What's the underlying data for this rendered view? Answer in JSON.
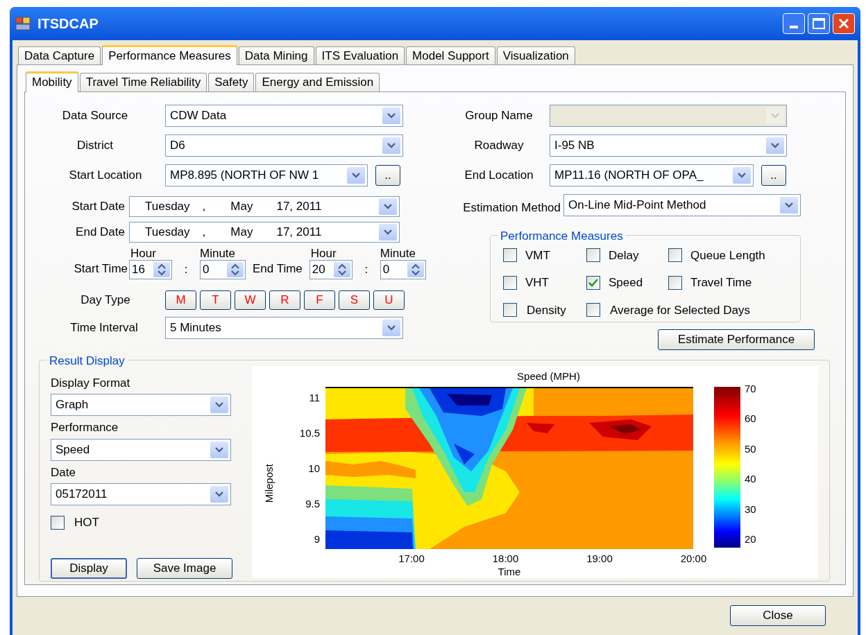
{
  "window": {
    "title": "ITSDCAP"
  },
  "tabs": [
    {
      "label": "Data Capture",
      "selected": false
    },
    {
      "label": "Performance Measures",
      "selected": true
    },
    {
      "label": "Data Mining",
      "selected": false
    },
    {
      "label": "ITS Evaluation",
      "selected": false
    },
    {
      "label": "Model Support",
      "selected": false
    },
    {
      "label": "Visualization",
      "selected": false
    }
  ],
  "subtabs": [
    {
      "label": "Mobility",
      "selected": true
    },
    {
      "label": "Travel Time Reliability",
      "selected": false
    },
    {
      "label": "Safety",
      "selected": false
    },
    {
      "label": "Energy and Emission",
      "selected": false
    }
  ],
  "data_source": {
    "label": "Data Source",
    "value": "CDW Data"
  },
  "district": {
    "label": "District",
    "value": "D6"
  },
  "start_location": {
    "label": "Start Location",
    "value": "MP8.895 (NORTH OF NW 1",
    "browse": ".."
  },
  "start_date": {
    "label": "Start Date",
    "weekday": "Tuesday",
    "sep": ",",
    "month": "May",
    "day": "17, 2011"
  },
  "end_date": {
    "label": "End Date",
    "weekday": "Tuesday",
    "sep": ",",
    "month": "May",
    "day": "17, 2011"
  },
  "start_time": {
    "label": "Start Time",
    "hour_label": "Hour",
    "hour": "16",
    "colon": ":",
    "minute_label": "Minute",
    "minute": "0"
  },
  "end_time": {
    "label": "End Time",
    "hour_label": "Hour",
    "hour": "20",
    "colon": ":",
    "minute_label": "Minute",
    "minute": "0"
  },
  "day_type": {
    "label": "Day Type",
    "days": [
      "M",
      "T",
      "W",
      "R",
      "F",
      "S",
      "U"
    ]
  },
  "time_interval": {
    "label": "Time Interval",
    "value": "5 Minutes"
  },
  "group_name": {
    "label": "Group Name",
    "disabled": true
  },
  "roadway": {
    "label": "Roadway",
    "value": "I-95 NB"
  },
  "end_location": {
    "label": "End Location",
    "value": "MP11.16 (NORTH OF OPA_",
    "browse": ".."
  },
  "estimation_method": {
    "label": "Estimation Method",
    "value": "On-Line Mid-Point Method"
  },
  "performance_measures": {
    "title": "Performance Measures",
    "options": [
      {
        "label": "VMT",
        "checked": false
      },
      {
        "label": "Delay",
        "checked": false
      },
      {
        "label": "Queue Length",
        "checked": false
      },
      {
        "label": "VHT",
        "checked": false
      },
      {
        "label": "Speed",
        "checked": true
      },
      {
        "label": "Travel Time",
        "checked": false
      },
      {
        "label": "Density",
        "checked": false
      },
      {
        "label": "Average for Selected Days",
        "checked": false
      }
    ]
  },
  "estimate_button": "Estimate Performance",
  "result_display": {
    "title": "Result Display",
    "display_format": {
      "label": "Display Format",
      "value": "Graph"
    },
    "performance": {
      "label": "Performance",
      "value": "Speed"
    },
    "date": {
      "label": "Date",
      "value": "05172011"
    },
    "hot": {
      "label": "HOT",
      "checked": false
    },
    "buttons": [
      "Display",
      "Save Image"
    ]
  },
  "plot": {
    "title": "Speed (MPH)",
    "xlabel": "Time",
    "ylabel": "Milepost",
    "xticks": [
      "17:00",
      "18:00",
      "19:00",
      "20:00"
    ],
    "yticks": [
      "11",
      "10.5",
      "10",
      "9.5",
      "9"
    ],
    "colorbar_ticks": [
      "70",
      "60",
      "50",
      "40",
      "30",
      "20"
    ]
  },
  "close_button": "Close"
}
